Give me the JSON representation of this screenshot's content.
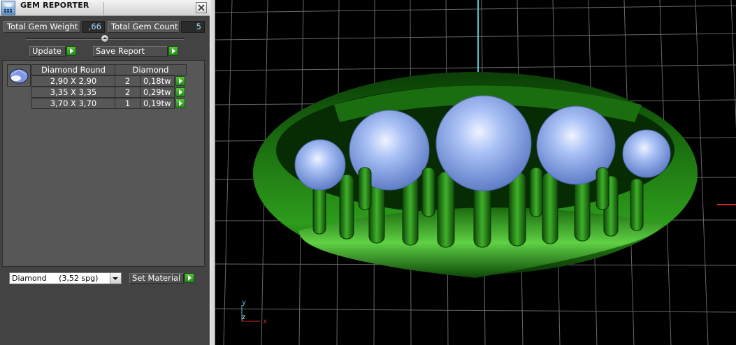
{
  "window": {
    "title": "GEM REPORTER"
  },
  "totals": {
    "weight_label": "Total Gem Weight",
    "weight_value": ",66",
    "count_label": "Total Gem Count",
    "count_value": "5"
  },
  "actions": {
    "update_label": "Update",
    "save_report_label": "Save Report"
  },
  "table": {
    "headers": [
      "Diamond Round",
      "Diamond"
    ],
    "rows": [
      {
        "size": "2,90 X 2,90",
        "qty": "2",
        "weight": "0,18tw"
      },
      {
        "size": "3,35 X 3,35",
        "qty": "2",
        "weight": "0,29tw"
      },
      {
        "size": "3,70 X 3,70",
        "qty": "1",
        "weight": "0,19tw"
      }
    ]
  },
  "material": {
    "selected": "Diamond     (3,52 spg)",
    "set_label": "Set Material"
  },
  "viewport": {
    "axis_y": "y",
    "axis_z": "z",
    "axis_x": "x"
  },
  "colors": {
    "ring": "#1f7a12",
    "gem": "#8fb0ee",
    "grid": "#7f7f7f",
    "go_button": "#34a52a"
  }
}
